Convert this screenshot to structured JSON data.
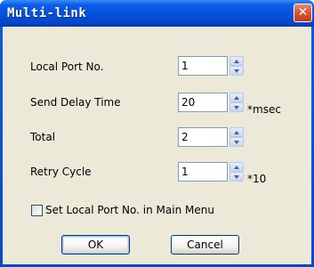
{
  "window": {
    "title": "Multi-link",
    "close_glyph": "✕"
  },
  "fields": [
    {
      "label": "Local Port No.",
      "value": "1",
      "unit": ""
    },
    {
      "label": "Send Delay Time",
      "value": "20",
      "unit": "*msec"
    },
    {
      "label": "Total",
      "value": "2",
      "unit": ""
    },
    {
      "label": "Retry Cycle",
      "value": "1",
      "unit": "*10"
    }
  ],
  "checkbox": {
    "label": "Set Local Port No. in Main Menu",
    "checked": false
  },
  "buttons": {
    "ok": "OK",
    "cancel": "Cancel"
  },
  "colors": {
    "titlebar": "#0553de",
    "dialog_bg": "#ece9d8",
    "close_button": "#d6543a"
  }
}
